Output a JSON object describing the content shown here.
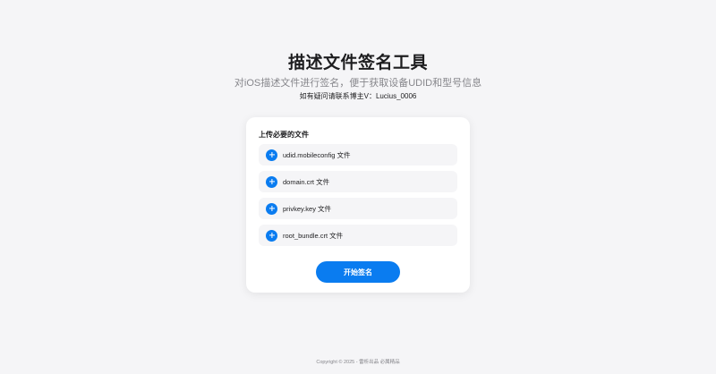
{
  "header": {
    "title": "描述文件签名工具",
    "subtitle": "对iOS描述文件进行签名，便于获取设备UDID和型号信息",
    "contact": "如有疑问请联系博主V：Lucius_0006"
  },
  "upload": {
    "section_title": "上传必要的文件",
    "files": [
      {
        "label": "udid.mobileconfig 文件",
        "icon": "plus-circle-icon"
      },
      {
        "label": "domain.crt 文件",
        "icon": "plus-circle-icon"
      },
      {
        "label": "privkey.key 文件",
        "icon": "plus-circle-icon"
      },
      {
        "label": "root_bundle.crt 文件",
        "icon": "plus-circle-icon"
      }
    ],
    "submit_label": "开始签名"
  },
  "footer": {
    "copyright": "Copyright © 2025 - 雷析出品 必属精品"
  },
  "colors": {
    "accent": "#0a7cf0",
    "background": "#f5f5f7",
    "card": "#ffffff",
    "text": "#1d1d1f",
    "muted": "#86868b"
  }
}
